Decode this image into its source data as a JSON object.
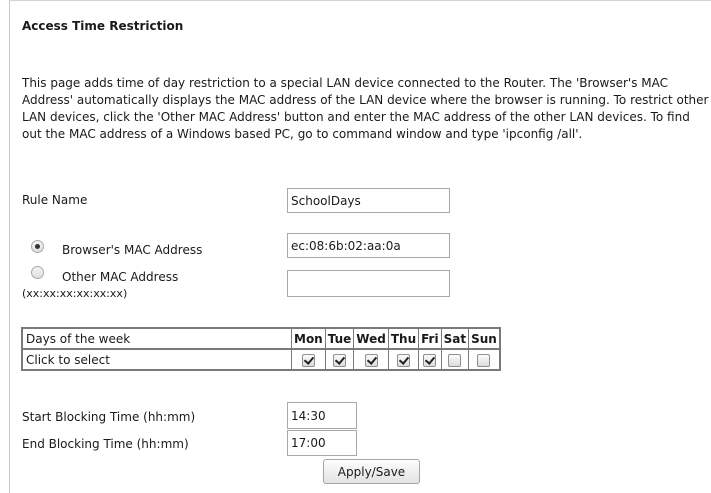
{
  "page": {
    "title": "Access Time Restriction",
    "description": "This page adds time of day restriction to a special LAN device connected to the Router. The 'Browser's MAC Address' automatically displays the MAC address of the LAN device where the browser is running. To restrict other LAN devices, click the 'Other MAC Address' button and enter the MAC address of the other LAN devices. To find out the MAC address of a Windows based PC, go to command window and type 'ipconfig /all'."
  },
  "form": {
    "rule_name_label": "Rule Name",
    "rule_name_value": "SchoolDays",
    "browser_mac_label": "Browser's MAC Address",
    "browser_mac_value": "ec:08:6b:02:aa:0a",
    "browser_mac_selected": true,
    "other_mac_label": "Other MAC Address",
    "other_mac_format": "(xx:xx:xx:xx:xx:xx)",
    "other_mac_value": "",
    "other_mac_selected": false
  },
  "days_table": {
    "header_label": "Days of the week",
    "row_label": "Click to select",
    "days": [
      {
        "label": "Mon",
        "checked": true
      },
      {
        "label": "Tue",
        "checked": true
      },
      {
        "label": "Wed",
        "checked": true
      },
      {
        "label": "Thu",
        "checked": true
      },
      {
        "label": "Fri",
        "checked": true
      },
      {
        "label": "Sat",
        "checked": false
      },
      {
        "label": "Sun",
        "checked": false
      }
    ]
  },
  "times": {
    "start_label": "Start Blocking Time (hh:mm)",
    "start_value": "14:30",
    "end_label": "End Blocking Time (hh:mm)",
    "end_value": "17:00"
  },
  "actions": {
    "apply_label": "Apply/Save"
  }
}
